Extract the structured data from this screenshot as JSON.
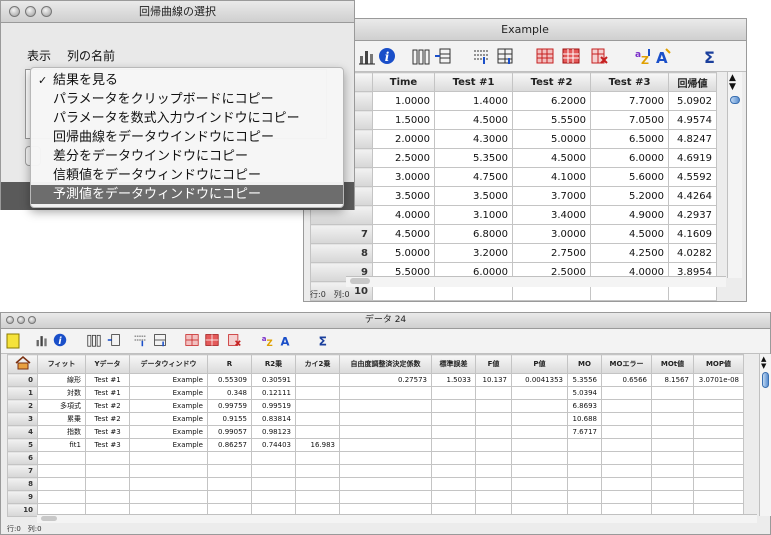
{
  "dialog": {
    "title": "回帰曲線の選択",
    "label_display": "表示",
    "label_column": "列の名前",
    "menu_items": [
      "結果を見る",
      "パラメータをクリップボードにコピー",
      "パラメータを数式入力ウインドウにコピー",
      "回帰曲線をデータウインドウにコピー",
      "差分をデータウインドウにコピー",
      "信頼値をデータウィンドウにコピー",
      "予測値をデータウィンドウにコピー"
    ],
    "selected_index": 6
  },
  "example": {
    "title": "Example",
    "columns": [
      "Time",
      "Test #1",
      "Test #2",
      "Test #3",
      "回帰値"
    ],
    "row_numbers": [
      "",
      "",
      "",
      "",
      "",
      "",
      "",
      "7",
      "8",
      "9",
      "10"
    ],
    "rows": [
      [
        "1.0000",
        "1.4000",
        "6.2000",
        "7.7000",
        "5.0902"
      ],
      [
        "1.5000",
        "4.5000",
        "5.5500",
        "7.0500",
        "4.9574"
      ],
      [
        "2.0000",
        "4.3000",
        "5.0000",
        "6.5000",
        "4.8247"
      ],
      [
        "2.5000",
        "5.3500",
        "4.5000",
        "6.0000",
        "4.6919"
      ],
      [
        "3.0000",
        "4.7500",
        "4.1000",
        "5.6000",
        "4.5592"
      ],
      [
        "3.5000",
        "3.5000",
        "3.7000",
        "5.2000",
        "4.4264"
      ],
      [
        "4.0000",
        "3.1000",
        "3.4000",
        "4.9000",
        "4.2937"
      ],
      [
        "4.5000",
        "6.8000",
        "3.0000",
        "4.5000",
        "4.1609"
      ],
      [
        "5.0000",
        "3.2000",
        "2.7500",
        "4.2500",
        "4.0282"
      ],
      [
        "5.5000",
        "6.0000",
        "2.5000",
        "4.0000",
        "3.8954"
      ],
      [
        "",
        "",
        "",
        "",
        ""
      ]
    ],
    "status": "行:0　列:0"
  },
  "data24": {
    "title": "データ 24",
    "columns": [
      "フィット",
      "Yデータ",
      "データウィンドウ",
      "R",
      "R2乗",
      "カイ2乗",
      "自由度調整済決定係数",
      "標準誤差",
      "F値",
      "P値",
      "MO",
      "MOエラー",
      "MOt値",
      "MOP値"
    ],
    "row_numbers": [
      "0",
      "1",
      "2",
      "3",
      "4",
      "5",
      "6",
      "7",
      "8",
      "9",
      "10"
    ],
    "rows": [
      [
        "線形",
        "Test #1",
        "Example",
        "0.55309",
        "0.30591",
        "",
        "0.27573",
        "1.5033",
        "10.137",
        "0.0041353",
        "5.3556",
        "0.6566",
        "8.1567",
        "3.0701e-08"
      ],
      [
        "対数",
        "Test #1",
        "Example",
        "0.348",
        "0.12111",
        "",
        "",
        "",
        "",
        "",
        "5.0394",
        "",
        "",
        ""
      ],
      [
        "多項式",
        "Test #2",
        "Example",
        "0.99759",
        "0.99519",
        "",
        "",
        "",
        "",
        "",
        "6.8693",
        "",
        "",
        ""
      ],
      [
        "累乗",
        "Test #2",
        "Example",
        "0.9155",
        "0.83814",
        "",
        "",
        "",
        "",
        "",
        "10.688",
        "",
        "",
        ""
      ],
      [
        "指数",
        "Test #3",
        "Example",
        "0.99057",
        "0.98123",
        "",
        "",
        "",
        "",
        "",
        "7.6717",
        "",
        "",
        ""
      ],
      [
        "fit1",
        "Test #3",
        "Example",
        "0.86257",
        "0.74403",
        "16.983",
        "",
        "",
        "",
        "",
        "",
        "",
        "",
        ""
      ],
      [
        "",
        "",
        "",
        "",
        "",
        "",
        "",
        "",
        "",
        "",
        "",
        "",
        "",
        ""
      ],
      [
        "",
        "",
        "",
        "",
        "",
        "",
        "",
        "",
        "",
        "",
        "",
        "",
        "",
        ""
      ],
      [
        "",
        "",
        "",
        "",
        "",
        "",
        "",
        "",
        "",
        "",
        "",
        "",
        "",
        ""
      ],
      [
        "",
        "",
        "",
        "",
        "",
        "",
        "",
        "",
        "",
        "",
        "",
        "",
        "",
        ""
      ],
      [
        "",
        "",
        "",
        "",
        "",
        "",
        "",
        "",
        "",
        "",
        "",
        "",
        "",
        ""
      ]
    ],
    "status": "行:0　列:0"
  },
  "toolbar_icons": [
    "chart-icon",
    "info-icon",
    "columns-icon",
    "insert-column-icon",
    "insert-row-icon",
    "table-icon",
    "grid-icon",
    "delete-icon",
    "sort-az-icon",
    "text-icon",
    "sigma-icon"
  ],
  "colors": {
    "selected_menu": "#6d6d6d",
    "header_bg": "#dadada",
    "info_blue": "#1a4fc9",
    "grid_red": "#c62020"
  }
}
